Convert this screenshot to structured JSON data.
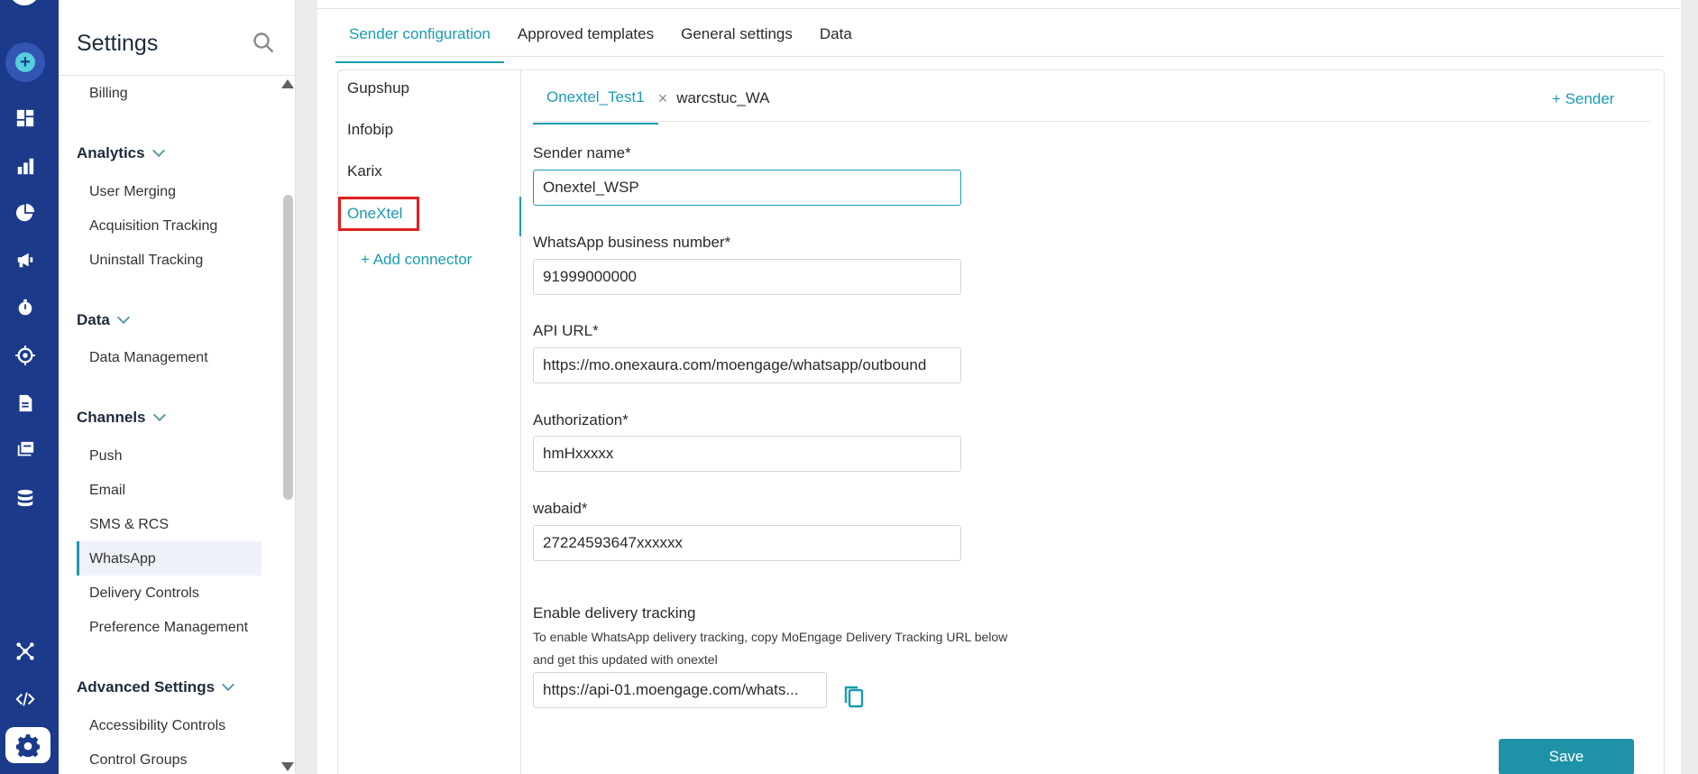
{
  "sidebar": {
    "title": "Settings",
    "items": {
      "billing": "Billing",
      "analytics_head": "Analytics",
      "user_merging": "User Merging",
      "acquisition_tracking": "Acquisition Tracking",
      "uninstall_tracking": "Uninstall Tracking",
      "data_head": "Data",
      "data_management": "Data Management",
      "channels_head": "Channels",
      "push": "Push",
      "email": "Email",
      "sms_rcs": "SMS & RCS",
      "whatsapp": "WhatsApp",
      "delivery_controls": "Delivery Controls",
      "preference_management": "Preference Management",
      "advanced_head": "Advanced Settings",
      "accessibility_controls": "Accessibility Controls",
      "control_groups": "Control Groups"
    }
  },
  "tabs": {
    "sender_configuration": "Sender configuration",
    "approved_templates": "Approved templates",
    "general_settings": "General settings",
    "data": "Data"
  },
  "connectors": {
    "gupshup": "Gupshup",
    "infobip": "Infobip",
    "karix": "Karix",
    "onextel": "OneXtel",
    "add_connector": "+ Add connector"
  },
  "senders": {
    "tab1": "Onextel_Test1",
    "close_symbol": "×",
    "tab2": "warcstuc_WA",
    "add_sender": "+ Sender"
  },
  "form": {
    "sender_name_label": "Sender name*",
    "sender_name_value": "Onextel_WSP",
    "whatsapp_number_label": "WhatsApp business number*",
    "whatsapp_number_value": "91999000000",
    "api_url_label": "API URL*",
    "api_url_value": "https://mo.onexaura.com/moengage/whatsapp/outbound",
    "authorization_label": "Authorization*",
    "authorization_value": "hmHxxxxx",
    "wabaid_label": "wabaid*",
    "wabaid_value": "27224593647xxxxxx",
    "delivery_tracking_label": "Enable delivery tracking",
    "delivery_help_line1": "To enable WhatsApp delivery tracking, copy MoEngage Delivery Tracking URL below",
    "delivery_help_line2": "and get this updated with onextel",
    "delivery_url_value": "https://api-01.moengage.com/whats...",
    "save_label": "Save"
  },
  "colors": {
    "rail": "#1b3a8a",
    "accent": "#1a9bb0",
    "highlight_outline": "#e0201c",
    "save_button": "#1e93a8"
  }
}
